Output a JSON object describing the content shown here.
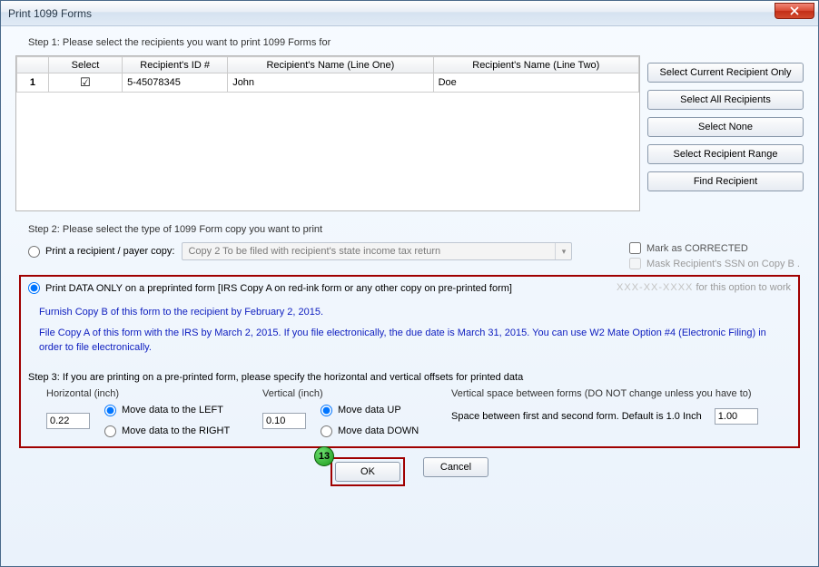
{
  "window": {
    "title": "Print 1099 Forms"
  },
  "step1": {
    "label": "Step 1: Please select the recipients you want to print 1099 Forms for",
    "columns": {
      "select": "Select",
      "id": "Recipient's ID #",
      "name1": "Recipient's Name (Line One)",
      "name2": "Recipient's Name (Line Two)"
    },
    "rows": [
      {
        "index": "1",
        "checked": true,
        "id": "5-45078345",
        "name1": "John",
        "name2": "Doe"
      }
    ],
    "buttons": {
      "select_current": "Select Current Recipient Only",
      "select_all": "Select All Recipients",
      "select_none": "Select None",
      "select_range": "Select Recipient Range",
      "find": "Find Recipient"
    }
  },
  "step2": {
    "label": "Step 2: Please select the type of 1099 Form copy you want to print",
    "radio_recipient": "Print a recipient / payer copy:",
    "combo_value": "Copy 2 To be filed with recipient's state income tax return",
    "mark_corrected": "Mark as CORRECTED",
    "mask_ssn": "Mask Recipient's SSN on Copy B .",
    "radio_preprinted": "Print DATA ONLY on a preprinted form [IRS Copy A on red-ink form or any other copy on pre-printed form]",
    "preprint_note_suffix": " for this option to work",
    "blue1": "Furnish Copy B of this form to the recipient by February 2, 2015.",
    "blue2": "File Copy A of this form with the IRS by March 2, 2015. If you file electronically, the due date is March 31, 2015. You can use W2 Mate Option #4 (Electronic Filing) in order to file electronically."
  },
  "step3": {
    "label": "Step 3: If you are printing on a pre-printed form, please specify the horizontal and vertical offsets for printed data",
    "horizontal": {
      "legend": "Horizontal (inch)",
      "value": "0.22",
      "opt_left": "Move data to the LEFT",
      "opt_right": "Move data to the RIGHT"
    },
    "vertical": {
      "legend": "Vertical (inch)",
      "value": "0.10",
      "opt_up": "Move data UP",
      "opt_down": "Move data DOWN"
    },
    "vspace": {
      "legend": "Vertical space between forms (DO NOT change unless you have to)",
      "text": "Space between first and second form. Default is 1.0 Inch",
      "value": "1.00"
    }
  },
  "buttons": {
    "ok": "OK",
    "cancel": "Cancel"
  },
  "annotation": {
    "number": "13"
  }
}
